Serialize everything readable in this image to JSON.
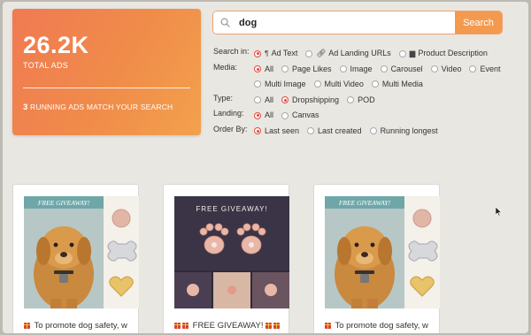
{
  "stats": {
    "total_ads": "26.2K",
    "total_label": "TOTAL ADS",
    "running_count": "3",
    "running_label": "RUNNING ADS MATCH YOUR SEARCH"
  },
  "search": {
    "query": "dog",
    "button_label": "Search"
  },
  "filters": {
    "search_in": {
      "label": "Search in:",
      "options": [
        {
          "label": "Ad Text",
          "icon": "paragraph-icon",
          "checked": true
        },
        {
          "label": "Ad Landing URLs",
          "icon": "link-icon",
          "checked": false
        },
        {
          "label": "Product Description",
          "icon": "document-icon",
          "checked": false
        }
      ]
    },
    "media": {
      "label": "Media:",
      "options": [
        {
          "label": "All",
          "checked": true
        },
        {
          "label": "Page Likes",
          "checked": false
        },
        {
          "label": "Image",
          "checked": false
        },
        {
          "label": "Carousel",
          "checked": false
        },
        {
          "label": "Video",
          "checked": false
        },
        {
          "label": "Event",
          "checked": false
        },
        {
          "label": "Multi Image",
          "checked": false
        },
        {
          "label": "Multi Video",
          "checked": false
        },
        {
          "label": "Multi Media",
          "checked": false
        }
      ]
    },
    "type": {
      "label": "Type:",
      "options": [
        {
          "label": "All",
          "checked": false
        },
        {
          "label": "Dropshipping",
          "checked": true
        },
        {
          "label": "POD",
          "checked": false
        }
      ]
    },
    "landing": {
      "label": "Landing:",
      "options": [
        {
          "label": "All",
          "checked": true
        },
        {
          "label": "Canvas",
          "checked": false
        }
      ]
    },
    "order_by": {
      "label": "Order By:",
      "options": [
        {
          "label": "Last seen",
          "checked": true
        },
        {
          "label": "Last created",
          "checked": false
        },
        {
          "label": "Running longest",
          "checked": false
        }
      ]
    }
  },
  "cards": [
    {
      "banner": "FREE GIVEAWAY!",
      "caption": "To promote dog safety, w"
    },
    {
      "banner": "FREE GIVEAWAY!",
      "caption": "FREE GIVEAWAY!"
    },
    {
      "banner": "FREE GIVEAWAY!",
      "caption": "To promote dog safety, w"
    }
  ],
  "colors": {
    "accent": "#f39a4e",
    "radio_checked": "#e0483c",
    "background": "#e9e7e2"
  }
}
